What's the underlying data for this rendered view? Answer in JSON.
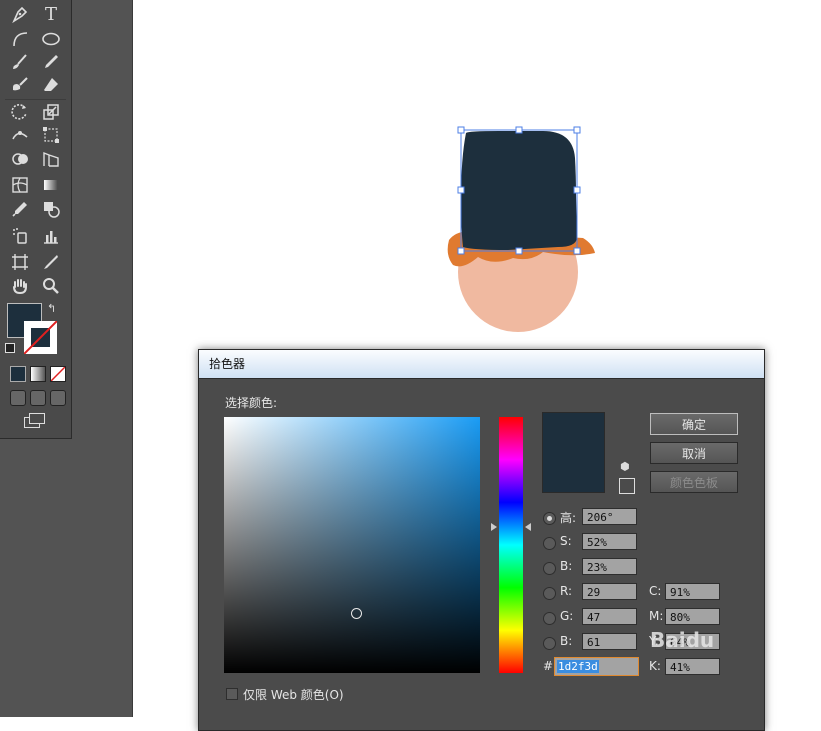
{
  "toolbox": {
    "tools": [
      "pen-tool",
      "type-tool",
      "arc-tool",
      "ellipse-tool",
      "paintbrush-tool",
      "pencil-tool",
      "blob-brush-tool",
      "eraser-tool",
      "rotate-tool",
      "scale-tool",
      "width-tool",
      "free-transform-tool",
      "shape-builder-tool",
      "perspective-grid-tool",
      "mesh-tool",
      "gradient-tool",
      "eyedropper-tool",
      "blend-tool",
      "symbol-sprayer-tool",
      "column-graph-tool",
      "artboard-tool",
      "slice-tool",
      "hand-tool",
      "zoom-tool"
    ],
    "fill_color": "#1d2f3d",
    "stroke_color": "none"
  },
  "dialog": {
    "title": "拾色器",
    "select_color_label": "选择颜色:",
    "buttons": {
      "ok": "确定",
      "cancel": "取消",
      "swatches": "颜色色板"
    },
    "hsb": [
      {
        "label": "高:",
        "value": "206°",
        "selected": true
      },
      {
        "label": "S:",
        "value": "52%"
      },
      {
        "label": "B:",
        "value": "23%"
      }
    ],
    "rgb": [
      {
        "label": "R:",
        "value": "29"
      },
      {
        "label": "G:",
        "value": "47"
      },
      {
        "label": "B:",
        "value": "61"
      }
    ],
    "cmyk": [
      {
        "label": "C:",
        "value": "91%"
      },
      {
        "label": "M:",
        "value": "80%"
      },
      {
        "label": "Y:",
        "value": "64%"
      },
      {
        "label": "K:",
        "value": "41%"
      }
    ],
    "hex_label": "#",
    "hex_value": "1d2f3d",
    "web_only_label": "仅限 Web 颜色(O)",
    "current_color": "#1d2f3d",
    "field_base_color": "#1a9cf5"
  },
  "watermark": "Baidu"
}
